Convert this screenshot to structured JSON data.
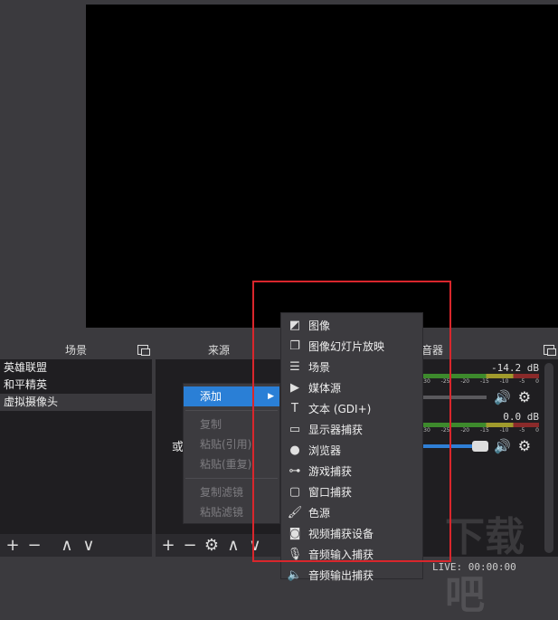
{
  "scenes": {
    "title": "场景",
    "items": [
      "英雄联盟",
      "和平精英",
      "虚拟摄像头"
    ],
    "selected": 2
  },
  "sources": {
    "title": "来源",
    "hint": "或"
  },
  "mixer": {
    "title": "音器",
    "tracks": [
      {
        "db": "-14.2 dB",
        "volume": 0.0
      },
      {
        "db": "0.0 dB",
        "volume": 1.0
      }
    ],
    "ticks": [
      "-30",
      "-25",
      "-20",
      "-15",
      "-10",
      "-5",
      "0"
    ]
  },
  "context_menu": {
    "items": [
      {
        "label": "添加",
        "active": true
      },
      {
        "label": "复制"
      },
      {
        "label": "粘贴(引用)"
      },
      {
        "label": "粘贴(重复)"
      },
      {
        "label": "复制滤镜"
      },
      {
        "label": "粘贴滤镜"
      }
    ]
  },
  "submenu": {
    "items": [
      {
        "icon": "image-icon",
        "glyph": "◩",
        "label": "图像"
      },
      {
        "icon": "slideshow-icon",
        "glyph": "❐",
        "label": "图像幻灯片放映"
      },
      {
        "icon": "list-icon",
        "glyph": "☰",
        "label": "场景"
      },
      {
        "icon": "play-icon",
        "glyph": "▶",
        "label": "媒体源"
      },
      {
        "icon": "text-icon",
        "glyph": "T",
        "label": "文本 (GDI+)"
      },
      {
        "icon": "monitor-icon",
        "glyph": "▭",
        "label": "显示器捕获"
      },
      {
        "icon": "globe-icon",
        "glyph": "●",
        "label": "浏览器"
      },
      {
        "icon": "gamepad-icon",
        "glyph": "⊶",
        "label": "游戏捕获"
      },
      {
        "icon": "window-icon",
        "glyph": "▢",
        "label": "窗口捕获"
      },
      {
        "icon": "brush-icon",
        "glyph": "🖌",
        "label": "色源"
      },
      {
        "icon": "camera-icon",
        "glyph": "◙",
        "label": "视频捕获设备"
      },
      {
        "icon": "microphone-icon",
        "glyph": "🎙",
        "label": "音频输入捕获"
      },
      {
        "icon": "speaker-icon",
        "glyph": "🔈",
        "label": "音频输出捕获"
      }
    ]
  },
  "status": {
    "live": "LIVE: 00:00:00"
  },
  "watermark": "下载吧"
}
